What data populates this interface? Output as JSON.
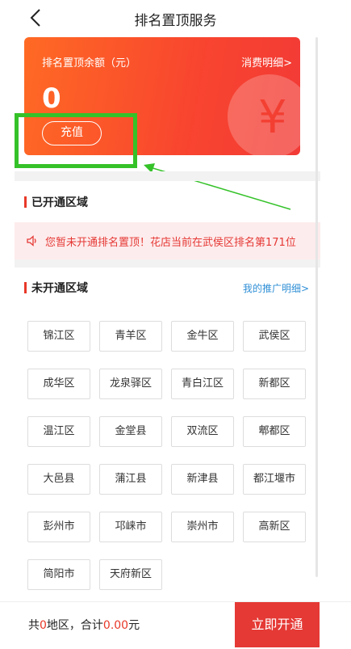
{
  "header": {
    "title": "排名置顶服务"
  },
  "card": {
    "balance_label": "排名置顶余额（元）",
    "detail_link": "消费明细>",
    "balance": "0",
    "recharge_label": "充值",
    "card_color": "#f8452f"
  },
  "opened": {
    "title": "已开通区域"
  },
  "notice": {
    "text": "您暂未开通排名置顶！花店当前在武侯区排名第171位"
  },
  "unopened": {
    "title": "未开通区域",
    "promo_link": "我的推广明细>",
    "districts": [
      "锦江区",
      "青羊区",
      "金牛区",
      "武侯区",
      "成华区",
      "龙泉驿区",
      "青白江区",
      "新都区",
      "温江区",
      "金堂县",
      "双流区",
      "郫都区",
      "大邑县",
      "蒲江县",
      "新津县",
      "都江堰市",
      "彭州市",
      "邛崃市",
      "崇州市",
      "高新区",
      "简阳市",
      "天府新区"
    ]
  },
  "footer": {
    "prefix": "共",
    "count": "0",
    "mid": "地区，合计",
    "amount": "0.00",
    "suffix": "元",
    "open_button": "立即开通"
  },
  "colors": {
    "accent": "#e53935",
    "link": "#2f8fd6",
    "highlight": "#35c229"
  }
}
